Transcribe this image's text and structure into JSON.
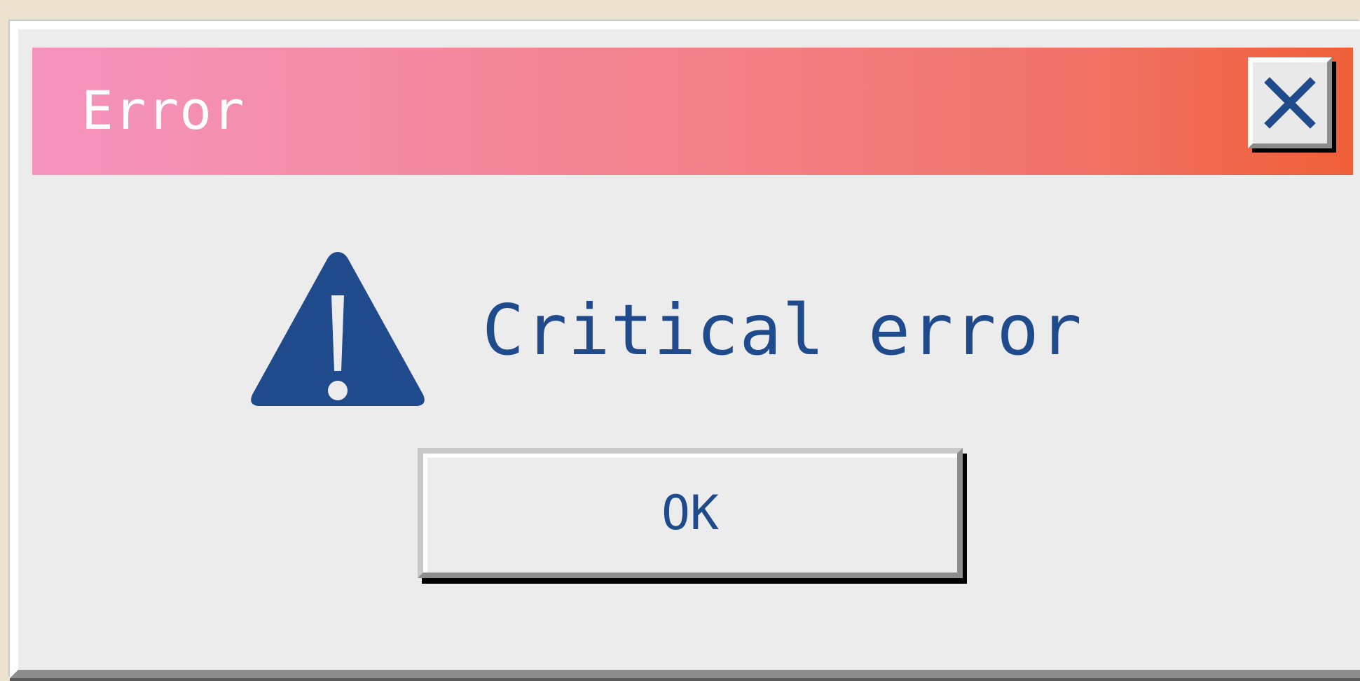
{
  "dialog": {
    "title": "Error",
    "message": "Critical error",
    "ok_label": "OK",
    "close_icon": "close-icon",
    "warning_icon": "warning-icon"
  },
  "colors": {
    "background": "#ede1d0",
    "window_body": "#ececec",
    "titlebar_gradient_start": "#f493bd",
    "titlebar_gradient_end": "#ef5f38",
    "accent_text": "#1f4a8c",
    "title_text": "#ffffff"
  }
}
